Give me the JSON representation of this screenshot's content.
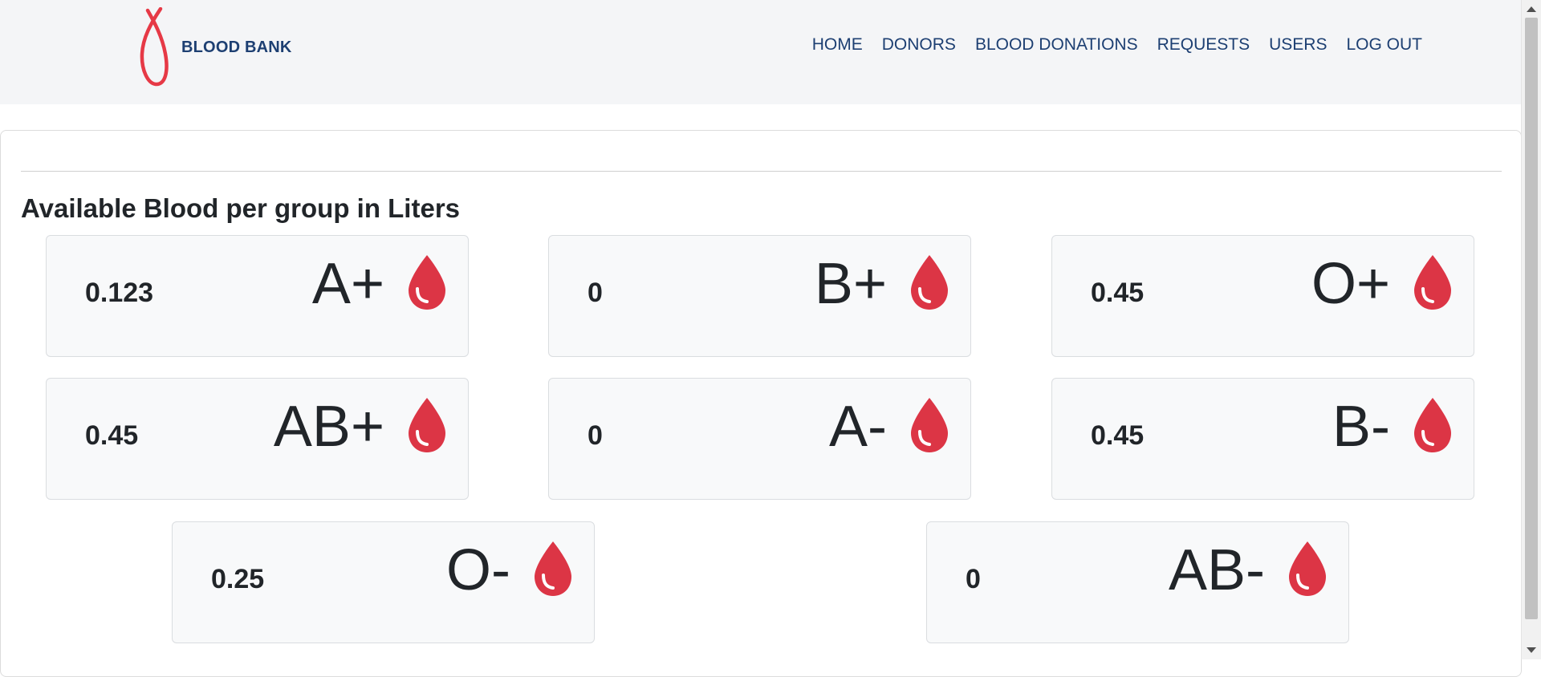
{
  "header": {
    "logo_text": "BLOOD BANK",
    "logo_icon": "ribbon-icon",
    "nav": [
      {
        "label": "HOME"
      },
      {
        "label": "DONORS"
      },
      {
        "label": "BLOOD DONATIONS"
      },
      {
        "label": "REQUESTS"
      },
      {
        "label": "USERS"
      },
      {
        "label": "LOG OUT"
      }
    ]
  },
  "main": {
    "title": "Available Blood per group in Liters",
    "groups": [
      {
        "group": "A+",
        "amount": "0.123",
        "icon": "blood-drop-icon"
      },
      {
        "group": "B+",
        "amount": "0",
        "icon": "blood-drop-icon"
      },
      {
        "group": "O+",
        "amount": "0.45",
        "icon": "blood-drop-icon"
      },
      {
        "group": "AB+",
        "amount": "0.45",
        "icon": "blood-drop-icon"
      },
      {
        "group": "A-",
        "amount": "0",
        "icon": "blood-drop-icon"
      },
      {
        "group": "B-",
        "amount": "0.45",
        "icon": "blood-drop-icon"
      },
      {
        "group": "O-",
        "amount": "0.25",
        "icon": "blood-drop-icon"
      },
      {
        "group": "AB-",
        "amount": "0",
        "icon": "blood-drop-icon"
      }
    ]
  },
  "colors": {
    "brand": "#1d3f72",
    "accent": "#dc3545",
    "header_bg": "#f4f5f7",
    "tile_bg": "#f8f9fa"
  }
}
